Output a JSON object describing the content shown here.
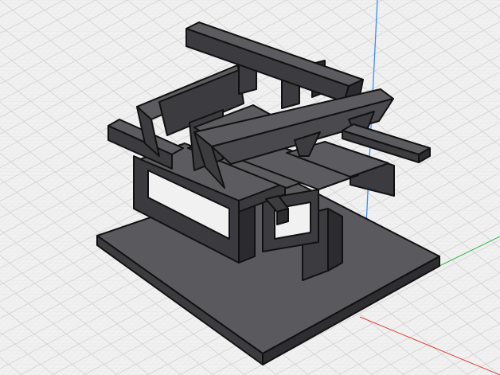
{
  "viewport": {
    "mode": "3d-perspective",
    "background": "#f1f1f1",
    "grid": {
      "visible": true,
      "minor_color": "#dcdcdc",
      "major_color": "#cfcfcf"
    },
    "axes": {
      "x_color": "#e0403a",
      "y_color": "#34b74c",
      "z_color": "#3d8bff"
    },
    "model": {
      "name": "timber-frame-model",
      "top_color": "#5c5c60",
      "side_color": "#3e3e42",
      "dark_color": "#2a2a2e",
      "edge_color": "#111111"
    }
  }
}
